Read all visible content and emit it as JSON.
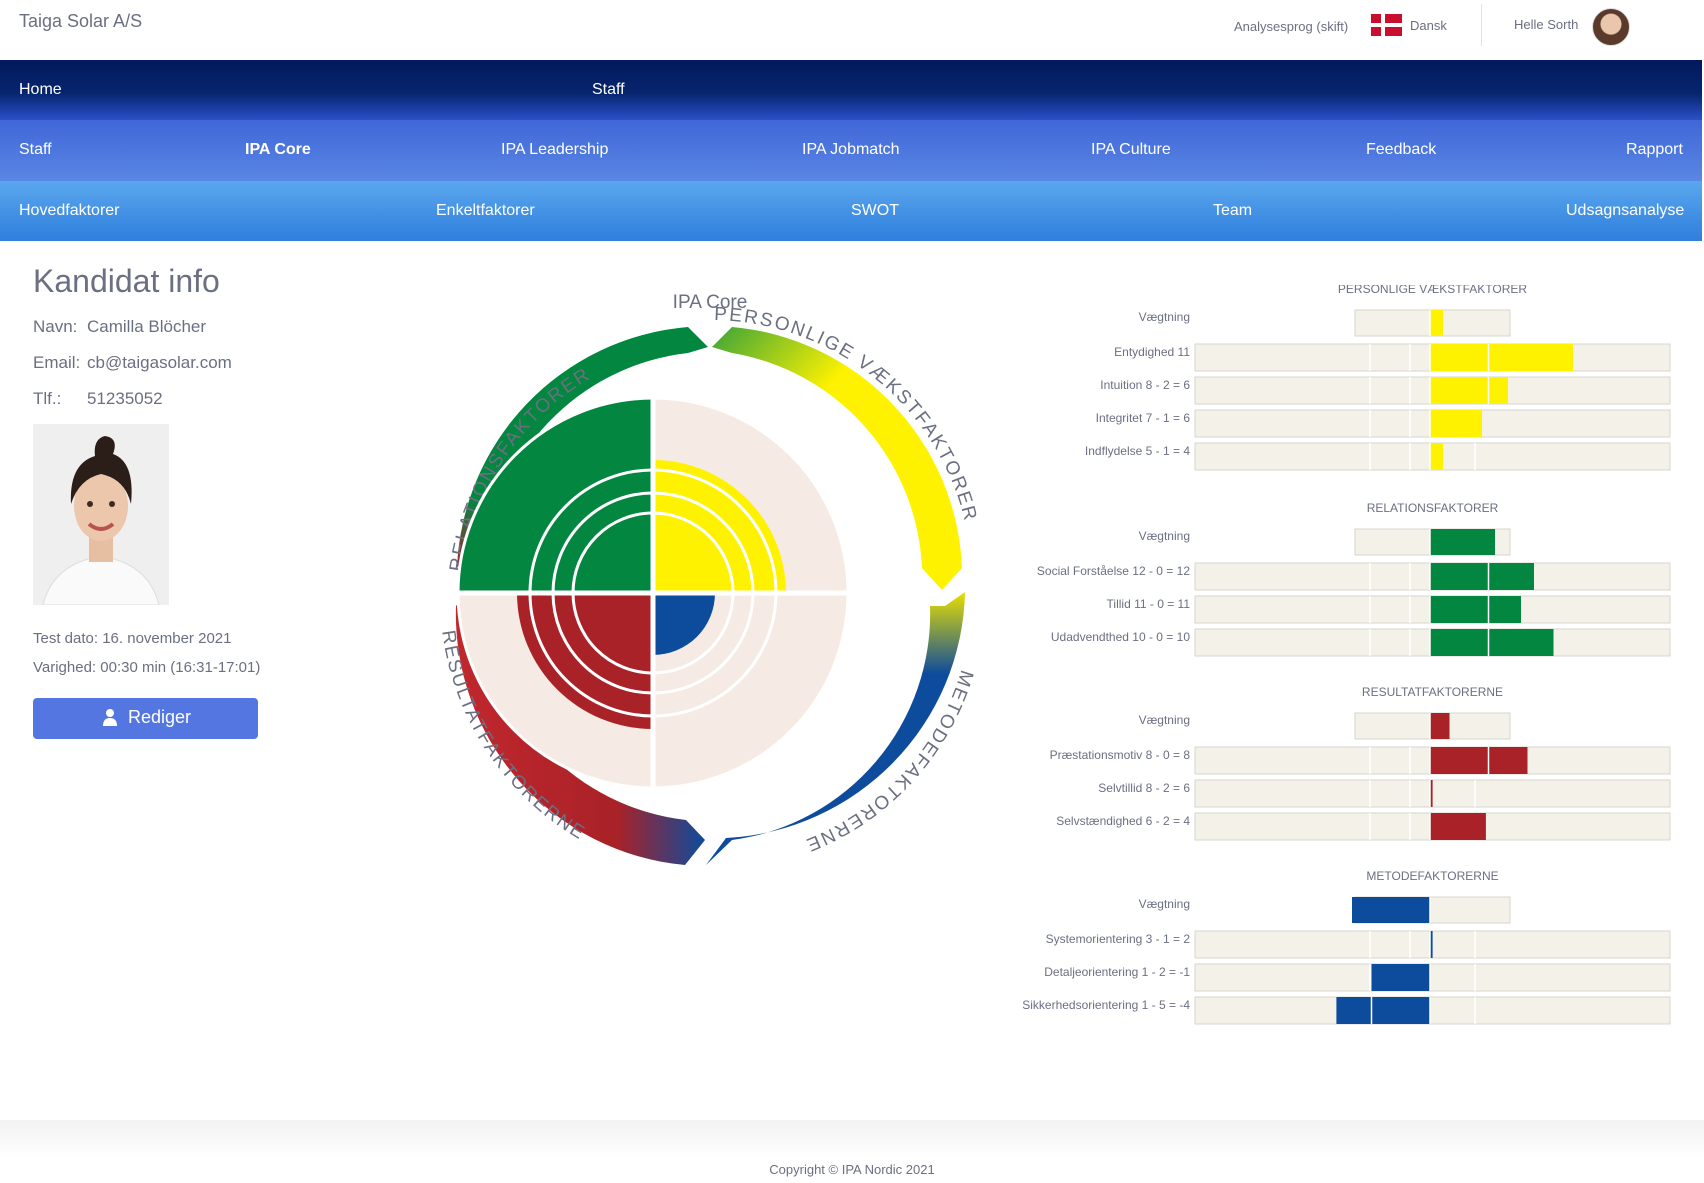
{
  "header": {
    "brand": "Taiga Solar A/S",
    "language_label": "Analysesprog (skift)",
    "language_value": "Dansk",
    "user_name": "Helle Sorth"
  },
  "nav": {
    "primary": [
      "Home",
      "Staff"
    ],
    "secondary": [
      "Staff",
      "IPA Core",
      "IPA Leadership",
      "IPA Jobmatch",
      "IPA Culture",
      "Feedback",
      "Rapport"
    ],
    "secondary_active": "IPA Core",
    "tertiary": [
      "Hovedfaktorer",
      "Enkeltfaktorer",
      "SWOT",
      "Team",
      "Udsagnsanalyse"
    ]
  },
  "candidate": {
    "title": "Kandidat info",
    "name_label": "Navn:",
    "name": "Camilla Blöcher",
    "email_label": "Email:",
    "email": "cb@taigasolar.com",
    "phone_label": "Tlf.:",
    "phone": "51235052",
    "test_date": "Test dato: 16. november 2021",
    "duration": "Varighed: 00:30 min (16:31-17:01)",
    "edit_button": "Rediger"
  },
  "wheel": {
    "title": "IPA Core",
    "arc_labels": [
      "RELATIONSFAKTORER",
      "PERSONLIGE VÆKSTFAKTORER",
      "METODEFAKTORERNE",
      "RESULTATFAKTORERNE"
    ]
  },
  "chart_data": {
    "type": "bar",
    "weight_label": "Vægtning",
    "groups": [
      {
        "name": "PERSONLIGE VÆKSTFAKTORER",
        "color": "#fff200",
        "weight": [
          0,
          1
        ],
        "factors": [
          {
            "label": "Entydighed 11",
            "value": 11
          },
          {
            "label": "Intuition 8 - 2 = 6",
            "value": 6
          },
          {
            "label": "Integritet 7 - 1 = 6",
            "value": 4
          },
          {
            "label": "Indflydelse 5 - 1 = 4",
            "value": 1
          }
        ]
      },
      {
        "name": "RELATIONSFAKTORER",
        "color": "#038640",
        "weight": [
          0,
          5
        ],
        "factors": [
          {
            "label": "Social Forståelse 12 - 0 = 12",
            "value": 8
          },
          {
            "label": "Tillid 11 - 0 = 11",
            "value": 7
          },
          {
            "label": "Udadvendthed 10 - 0 = 10",
            "value": 9.5
          }
        ]
      },
      {
        "name": "RESULTATFAKTORERNE",
        "color": "#a82228",
        "weight": [
          0,
          1.5
        ],
        "factors": [
          {
            "label": "Præstationsmotiv 8 - 0 = 8",
            "value": 7.5
          },
          {
            "label": "Selvtillid 8 - 2 = 6",
            "value": 0.2
          },
          {
            "label": "Selvstændighed 6 - 2 = 4",
            "value": 4.3
          }
        ]
      },
      {
        "name": "METODEFAKTORERNE",
        "color": "#0d4b9c",
        "weight": [
          -6,
          0
        ],
        "factors": [
          {
            "label": "Systemorientering 3 - 1 = 2",
            "value": 0.2
          },
          {
            "label": "Detaljeorientering 1 - 2 = -1",
            "value": -4.5
          },
          {
            "label": "Sikkerhedsorientering 1 - 5 = -4",
            "value": -7.2
          }
        ]
      }
    ]
  },
  "footer": {
    "copyright": "Copyright © IPA Nordic 2021"
  }
}
